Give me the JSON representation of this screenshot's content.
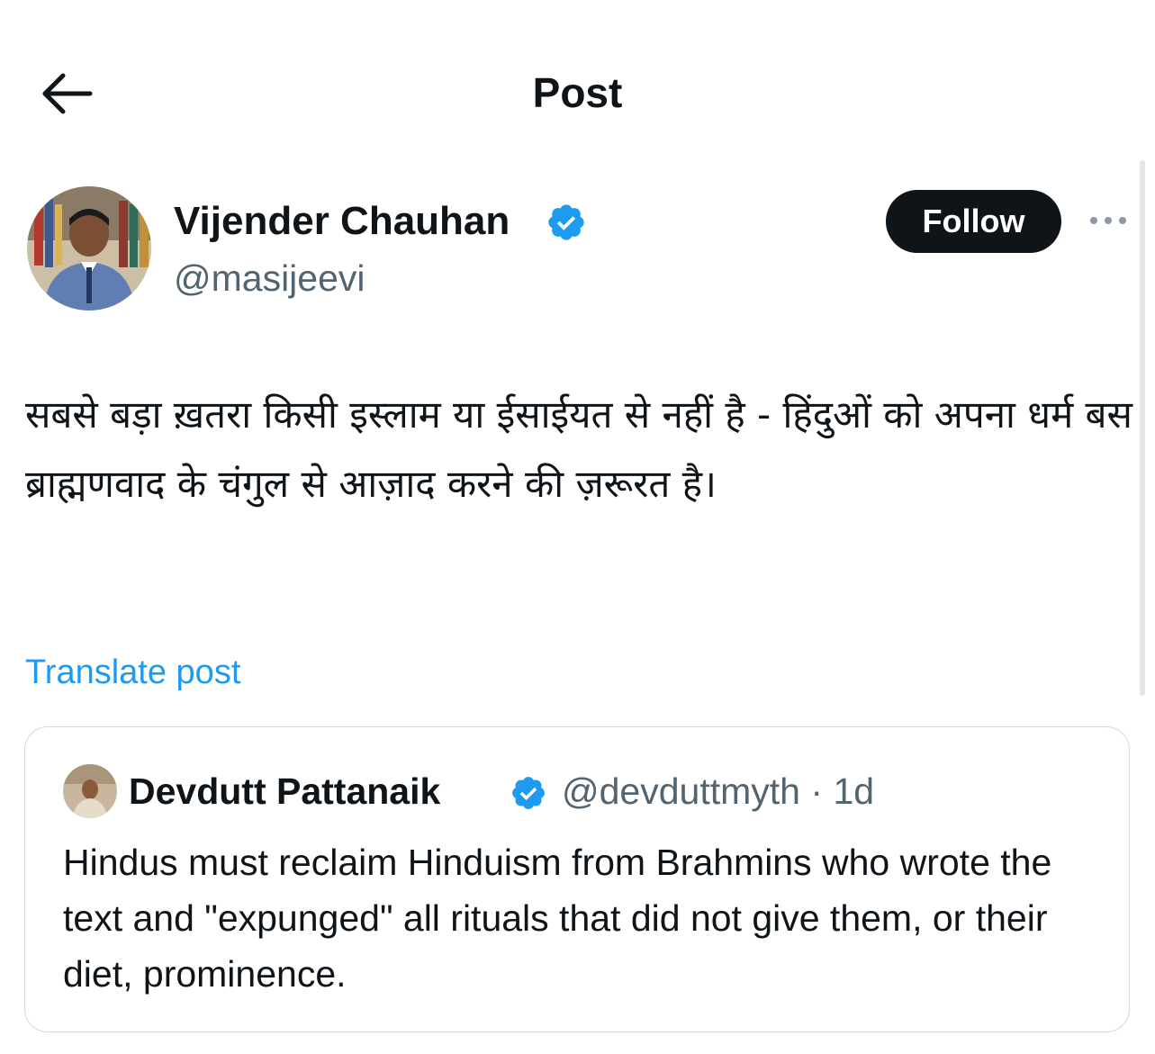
{
  "header": {
    "title": "Post",
    "back_icon": "arrow-left-icon"
  },
  "author": {
    "display_name": "Vijender Chauhan",
    "handle": "@masijeevi",
    "verified": true,
    "verified_icon": "verified-badge-icon",
    "avatar_icon": "avatar"
  },
  "actions": {
    "follow_label": "Follow",
    "more_icon": "more-options-icon"
  },
  "post": {
    "text": "सबसे बड़ा ख़तरा किसी इस्लाम या ईसाईयत से नहीं है - हिंदुओं को अपना धर्म बस ब्राह्मणवाद के चंगुल से आज़ाद करने की ज़रूरत है।",
    "translate_label": "Translate post"
  },
  "quoted_post": {
    "display_name": "Devdutt Pattanaik",
    "handle": "@devduttmyth",
    "separator": "·",
    "age": "1d",
    "verified": true,
    "text": "Hindus must reclaim Hinduism from Brahmins who wrote the text and \"expunged\" all rituals that did not give them, or their diet, prominence."
  },
  "colors": {
    "text": "#0f1419",
    "secondary": "#536471",
    "link": "#1d9bf0",
    "verified": "#1d9bf0",
    "border": "#cfd9de",
    "follow_bg": "#0f1419"
  }
}
